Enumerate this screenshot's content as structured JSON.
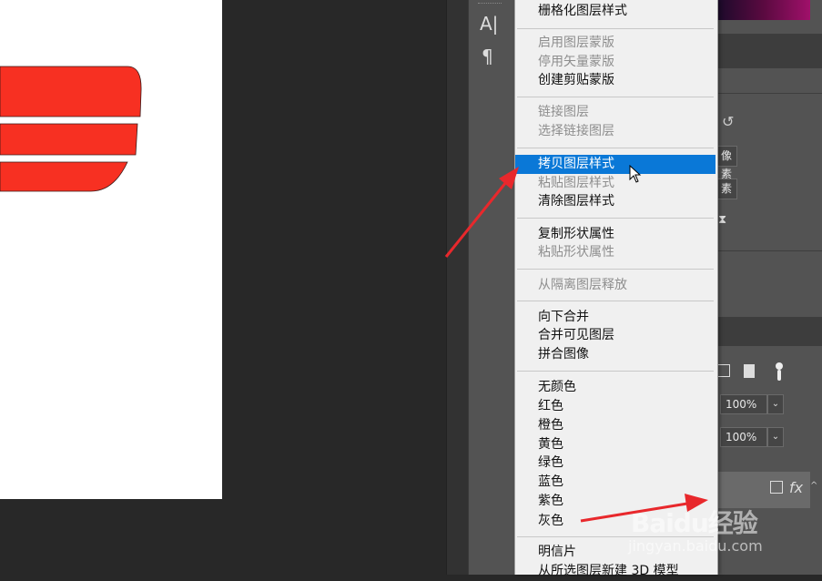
{
  "toolstrip": {
    "type_tool_glyph": "A|",
    "paragraph_glyph": "¶"
  },
  "menu": {
    "items": [
      {
        "label": "栅格化图层样式",
        "enabled": true
      },
      {
        "label": "启用图层蒙版",
        "enabled": false
      },
      {
        "label": "停用矢量蒙版",
        "enabled": false
      },
      {
        "label": "创建剪贴蒙版",
        "enabled": true
      },
      {
        "label": "链接图层",
        "enabled": false
      },
      {
        "label": "选择链接图层",
        "enabled": false
      },
      {
        "label": "拷贝图层样式",
        "enabled": true,
        "highlighted": true
      },
      {
        "label": "粘贴图层样式",
        "enabled": false
      },
      {
        "label": "清除图层样式",
        "enabled": true
      },
      {
        "label": "复制形状属性",
        "enabled": true
      },
      {
        "label": "粘贴形状属性",
        "enabled": false
      },
      {
        "label": "从隔离图层释放",
        "enabled": false
      },
      {
        "label": "向下合并",
        "enabled": true
      },
      {
        "label": "合并可见图层",
        "enabled": true
      },
      {
        "label": "拼合图像",
        "enabled": true
      },
      {
        "label": "无颜色",
        "enabled": true
      },
      {
        "label": "红色",
        "enabled": true
      },
      {
        "label": "橙色",
        "enabled": true
      },
      {
        "label": "黄色",
        "enabled": true
      },
      {
        "label": "绿色",
        "enabled": true
      },
      {
        "label": "蓝色",
        "enabled": true
      },
      {
        "label": "紫色",
        "enabled": true
      },
      {
        "label": "灰色",
        "enabled": true
      },
      {
        "label": "明信片",
        "enabled": true
      },
      {
        "label": "从所选图层新建 3D 模型",
        "enabled": true
      }
    ]
  },
  "properties": {
    "btn_pixels_1": "像素",
    "btn_pixels_2": "素"
  },
  "layers": {
    "opacity": "100%",
    "fill": "100%",
    "fx_label": "fx"
  },
  "watermark": {
    "logo": "Baidu经验",
    "url": "jingyan.baidu.com"
  },
  "colors": {
    "accent": "#0a78d7",
    "shape_red": "#f73022",
    "annotation_arrow": "#e8282c"
  }
}
